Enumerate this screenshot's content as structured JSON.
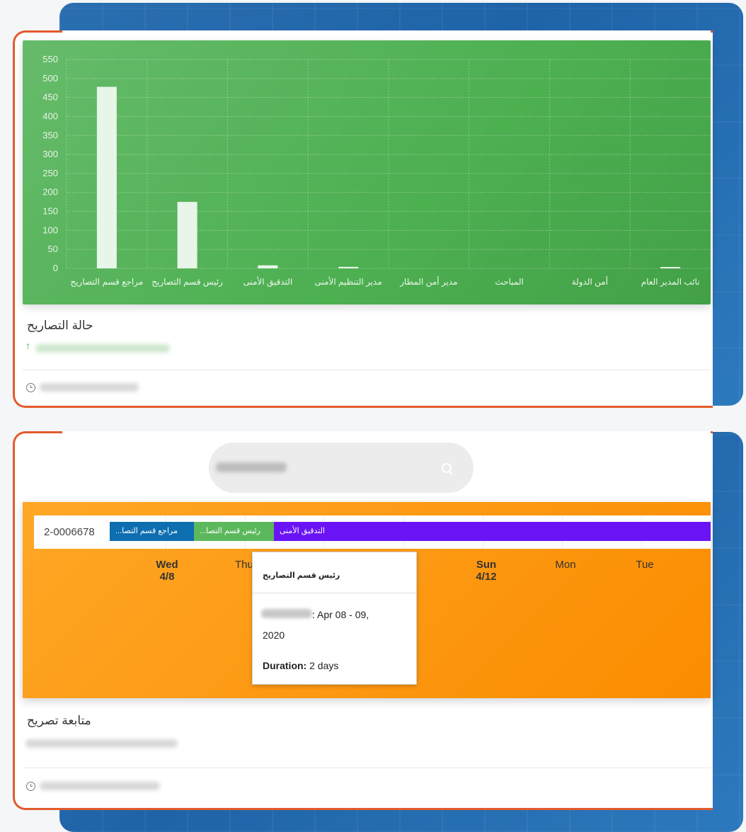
{
  "chart_card": {
    "title": "حالة التصاريح",
    "chart_data": {
      "type": "bar",
      "categories": [
        "مراجع قسم التصاريح",
        "رئيس قسم التصاريح",
        "التدقيق الأمنى",
        "مدير التنظيم الأمنى",
        "مدير أمن المطار",
        "المباحث",
        "أمن الدولة",
        "نائب المدير العام"
      ],
      "values": [
        478,
        175,
        8,
        4,
        0,
        0,
        0,
        3
      ],
      "ylim": [
        0,
        550
      ],
      "yticks": [
        0,
        50,
        100,
        150,
        200,
        250,
        300,
        350,
        400,
        450,
        500,
        550
      ],
      "grid": true,
      "bar_color": "#e8f5e9",
      "background": "#4caf50"
    }
  },
  "tracking_card": {
    "title": "متابعة تصريح",
    "gantt": {
      "row_id": "2-0006678",
      "segments": [
        {
          "label": "...مراجع قسم التصا",
          "color": "#0d6eb0"
        },
        {
          "label": "...رئيس قسم التصا",
          "color": "#5cb85c"
        },
        {
          "label": "التدقيق الأمنى",
          "color": "#6a14f5"
        }
      ],
      "days": [
        {
          "name": "Wed",
          "date": "4/8"
        },
        {
          "name": "Thu",
          "date": ""
        },
        {
          "name": "Sun",
          "date": "4/12"
        },
        {
          "name": "Mon",
          "date": ""
        },
        {
          "name": "Tue",
          "date": ""
        }
      ]
    },
    "tooltip": {
      "title": "رئيس قسم التصاريح",
      "date_range": ": Apr 08 - 09,",
      "year": "2020",
      "duration_label": "Duration:",
      "duration_value": " 2 days"
    }
  },
  "colors": {
    "accent": "#e35a2c",
    "chart_bg": "#4caf50",
    "gantt_bg": "#fb8c00"
  },
  "icons": {
    "search": "search-icon",
    "clock": "clock-icon",
    "arrow": "arrow-up-icon"
  }
}
